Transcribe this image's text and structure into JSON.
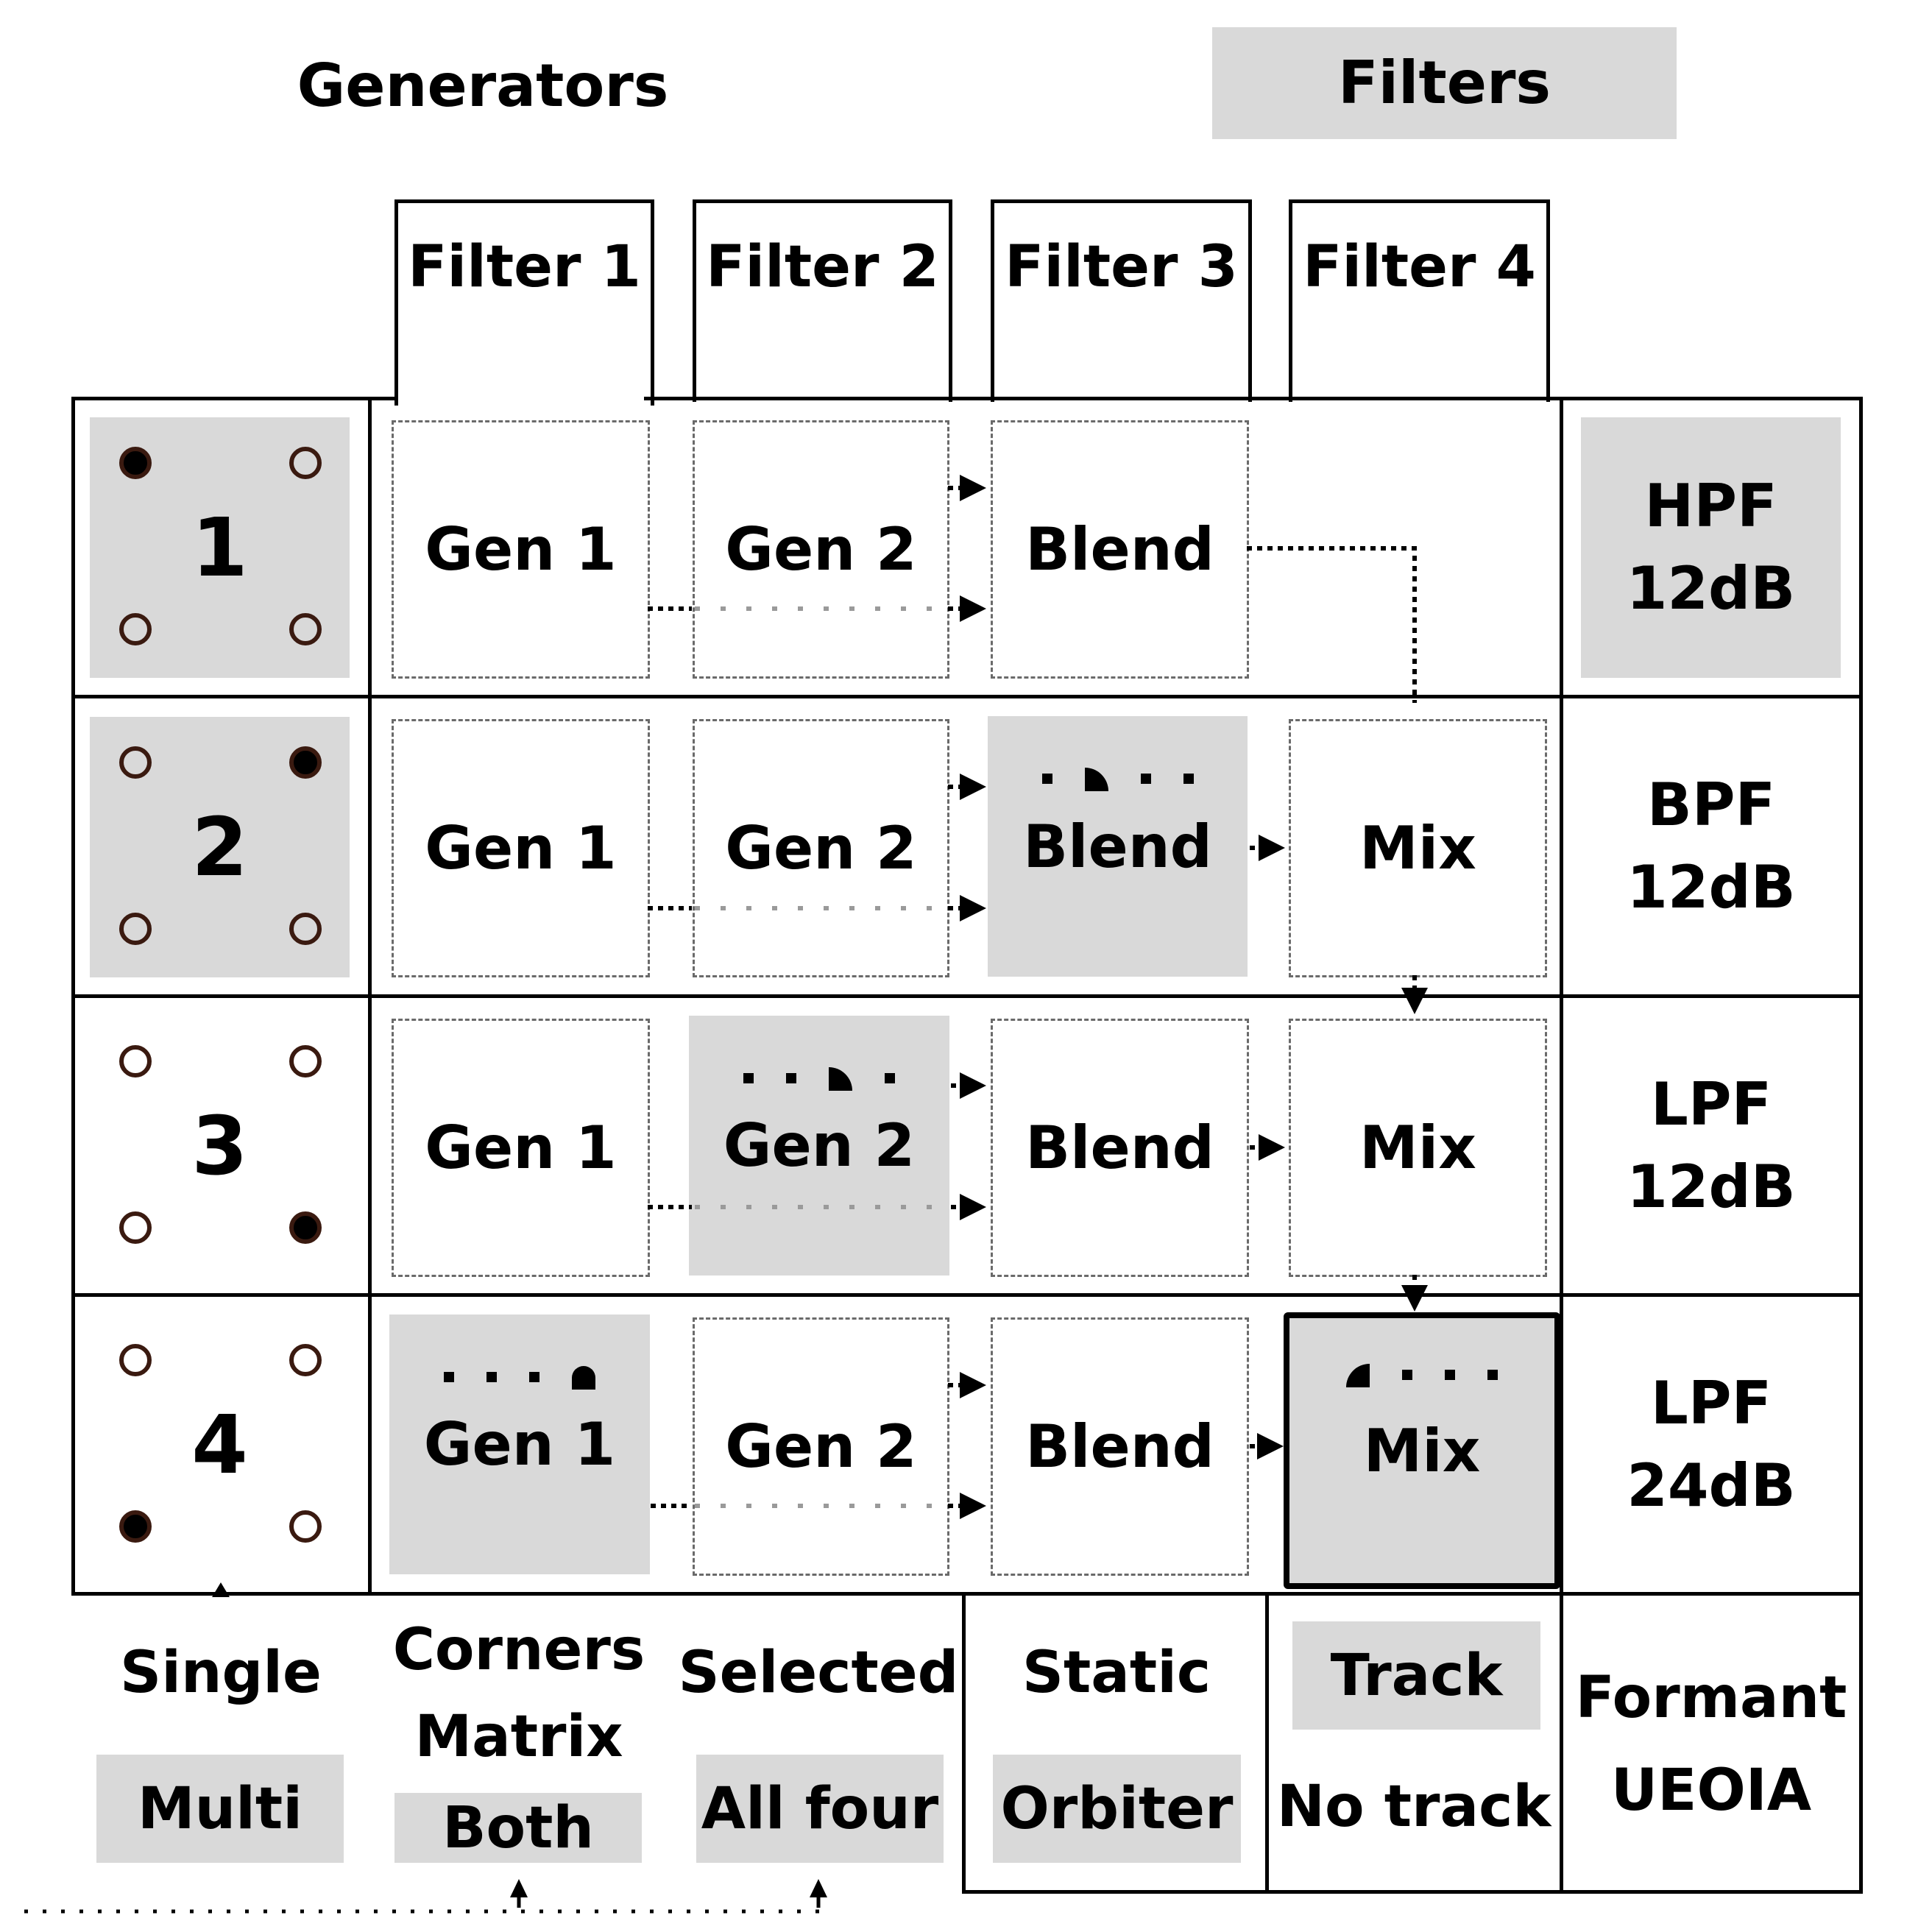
{
  "headers": {
    "generators_label": "Generators",
    "filters_label": "Filters"
  },
  "filter_tabs": [
    {
      "label": "Filter 1",
      "active": true
    },
    {
      "label": "Filter 2",
      "active": false
    },
    {
      "label": "Filter 3",
      "active": false
    },
    {
      "label": "Filter 4",
      "active": false
    }
  ],
  "rows": [
    {
      "number": "1",
      "number_highlighted": true,
      "corners": [
        true,
        false,
        false,
        false
      ],
      "cells": [
        {
          "label": "Gen 1",
          "state": "dashed"
        },
        {
          "label": "Gen 2",
          "state": "dashed"
        },
        {
          "label": "Blend",
          "state": "dashed"
        },
        {
          "label": "",
          "state": "empty"
        }
      ],
      "filter_type": [
        "HPF",
        "12dB"
      ],
      "filter_type_highlighted": true
    },
    {
      "number": "2",
      "number_highlighted": true,
      "corners": [
        false,
        true,
        false,
        false
      ],
      "cells": [
        {
          "label": "Gen 1",
          "state": "dashed"
        },
        {
          "label": "Gen 2",
          "state": "dashed"
        },
        {
          "label": "Blend",
          "state": "filled",
          "indicator": {
            "active_step": 2,
            "steps": 4,
            "shape": "q-right"
          }
        },
        {
          "label": "Mix",
          "state": "dashed"
        }
      ],
      "filter_type": [
        "BPF",
        "12dB"
      ],
      "filter_type_highlighted": false
    },
    {
      "number": "3",
      "number_highlighted": false,
      "corners": [
        false,
        false,
        false,
        true
      ],
      "cells": [
        {
          "label": "Gen 1",
          "state": "dashed"
        },
        {
          "label": "Gen 2",
          "state": "filled",
          "indicator": {
            "active_step": 3,
            "steps": 4,
            "shape": "q-right"
          }
        },
        {
          "label": "Blend",
          "state": "dashed"
        },
        {
          "label": "Mix",
          "state": "dashed"
        }
      ],
      "filter_type": [
        "LPF",
        "12dB"
      ],
      "filter_type_highlighted": false
    },
    {
      "number": "4",
      "number_highlighted": false,
      "corners": [
        false,
        false,
        true,
        false
      ],
      "cells": [
        {
          "label": "Gen 1",
          "state": "filled",
          "indicator": {
            "active_step": 4,
            "steps": 4,
            "shape": "dome"
          }
        },
        {
          "label": "Gen 2",
          "state": "dashed"
        },
        {
          "label": "Blend",
          "state": "dashed"
        },
        {
          "label": "Mix",
          "state": "selected",
          "indicator": {
            "active_step": 1,
            "steps": 4,
            "shape": "q-left"
          }
        }
      ],
      "filter_type": [
        "LPF",
        "24dB"
      ],
      "filter_type_highlighted": false
    }
  ],
  "bottom_options": {
    "mode": {
      "label": "Single",
      "option": "Multi",
      "option_highlighted": true
    },
    "corners": {
      "label1": "Corners",
      "label2": "Matrix",
      "option": "Both",
      "option_highlighted": true
    },
    "scope": {
      "label": "Selected",
      "option": "All four",
      "option_highlighted": true
    },
    "motion": {
      "label": "Static",
      "option": "Orbiter",
      "option_highlighted": true
    },
    "tracking": {
      "option": "Track",
      "label": "No track",
      "option_highlighted": true
    },
    "formant": {
      "label": "Formant",
      "value": "UEOIA"
    }
  },
  "colors": {
    "highlight_gray": "#d9d9d9",
    "corner_stroke": "#3a1a10",
    "line": "#000000",
    "dashed_border": "#6a6a6a"
  }
}
